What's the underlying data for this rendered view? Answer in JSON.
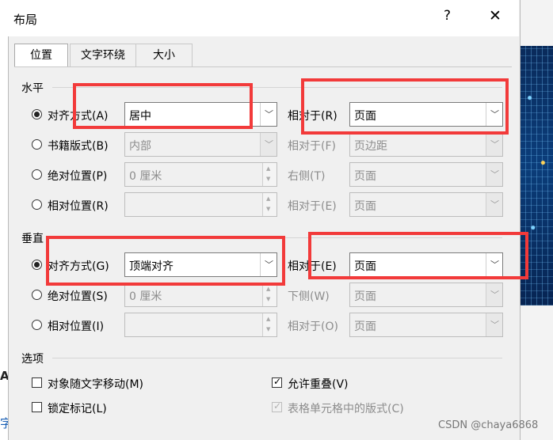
{
  "dialog": {
    "title": "布局",
    "help": "?",
    "close": "✕"
  },
  "tabs": [
    "位置",
    "文字环绕",
    "大小"
  ],
  "horizontal": {
    "group_label": "水平",
    "rows": [
      {
        "label": "对齐方式(A)",
        "value": "居中",
        "rel_label": "相对于(R)",
        "rel_value": "页面"
      },
      {
        "label": "书籍版式(B)",
        "value": "内部",
        "rel_label": "相对于(F)",
        "rel_value": "页边距"
      },
      {
        "label": "绝对位置(P)",
        "value": "0 厘米",
        "rel_label": "右侧(T)",
        "rel_value": "页面"
      },
      {
        "label": "相对位置(R)",
        "value": "",
        "rel_label": "相对于(E)",
        "rel_value": "页面"
      }
    ]
  },
  "vertical": {
    "group_label": "垂直",
    "rows": [
      {
        "label": "对齐方式(G)",
        "value": "顶端对齐",
        "rel_label": "相对于(E)",
        "rel_value": "页面"
      },
      {
        "label": "绝对位置(S)",
        "value": "0 厘米",
        "rel_label": "下侧(W)",
        "rel_value": "页面"
      },
      {
        "label": "相对位置(I)",
        "value": "",
        "rel_label": "相对于(O)",
        "rel_value": "页面"
      }
    ]
  },
  "options": {
    "group_label": "选项",
    "move_with_text": "对象随文字移动(M)",
    "lock_anchor": "锁定标记(L)",
    "allow_overlap": "允许重叠(V)",
    "layout_in_cell": "表格单元格中的版式(C)"
  },
  "background": {
    "left_a": "A",
    "left_b": "字"
  },
  "watermark": "CSDN @chaya6868",
  "annotation_color": "#f23a3a"
}
